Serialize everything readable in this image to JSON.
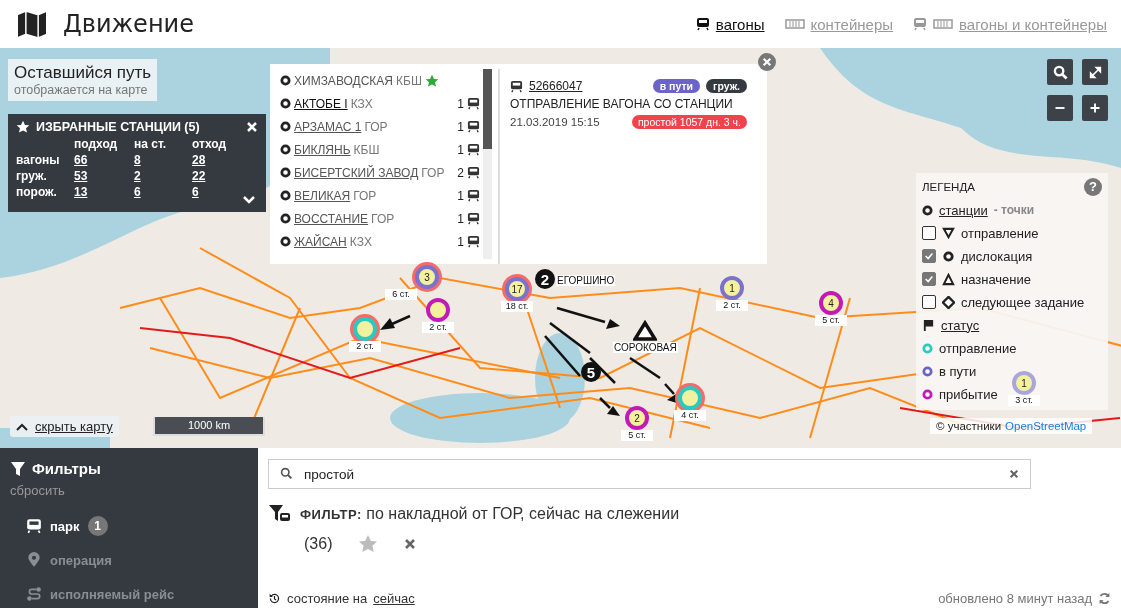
{
  "header": {
    "title": "Движение",
    "tabs": [
      {
        "label": "вагоны",
        "selected": true
      },
      {
        "label": "контейнеры",
        "selected": false
      },
      {
        "label": "вагоны и контейнеры",
        "selected": false
      }
    ]
  },
  "map": {
    "remaining_path": {
      "title": "Оставшийся путь",
      "subtitle": "отображается на карте"
    },
    "favorites": {
      "title": "ИЗБРАННЫЕ СТАНЦИИ (5)",
      "columns": [
        "подход",
        "на ст.",
        "отход"
      ],
      "rows": [
        {
          "label": "вагоны",
          "values": [
            "66",
            "8",
            "28"
          ]
        },
        {
          "label": "груж.",
          "values": [
            "53",
            "2",
            "22"
          ]
        },
        {
          "label": "порож.",
          "values": [
            "13",
            "6",
            "6"
          ]
        }
      ]
    },
    "popup": {
      "stations": [
        {
          "name": "ХИМЗАВОДСКАЯ",
          "road": "КБШ",
          "favorite": true,
          "selected": false
        },
        {
          "name": "АКТОБЕ I",
          "road": "КЗХ",
          "count": "1",
          "favorite": false,
          "selected": true
        },
        {
          "name": "АРЗАМАС 1",
          "road": "ГОР",
          "count": "1",
          "favorite": false,
          "selected": false
        },
        {
          "name": "БИКЛЯНЬ",
          "road": "КБШ",
          "count": "1",
          "favorite": false,
          "selected": false
        },
        {
          "name": "БИСЕРТСКИЙ ЗАВОД",
          "road": "ГОР",
          "count": "2",
          "favorite": false,
          "selected": false
        },
        {
          "name": "ВЕЛИКАЯ",
          "road": "ГОР",
          "count": "1",
          "favorite": false,
          "selected": false
        },
        {
          "name": "ВОССТАНИЕ",
          "road": "ГОР",
          "count": "1",
          "favorite": false,
          "selected": false
        },
        {
          "name": "ЖАЙСАН",
          "road": "КЗХ",
          "count": "1",
          "favorite": false,
          "selected": false
        }
      ],
      "wagon": {
        "number": "52666047",
        "badges": [
          {
            "text": "в пути",
            "color": "#6c63c9"
          },
          {
            "text": "груж.",
            "color": "#343a40"
          }
        ],
        "operation": "ОТПРАВЛЕНИЕ ВАГОНА СО СТАНЦИИ",
        "datetime": "21.03.2019 15:15",
        "idle": "простой 1057 дн. 3 ч."
      }
    },
    "markers": [
      {
        "count": "3",
        "label": "6 ст.",
        "color": "#7b72cc",
        "alert": true
      },
      {
        "label": "2 ст.",
        "color": "#c21bb5",
        "alert": false
      },
      {
        "label": "2 ст.",
        "color": "#2bc9c0",
        "alert": true
      },
      {
        "count": "17",
        "label": "18 ст.",
        "color": "#7b72cc",
        "alert": true
      },
      {
        "count": "1",
        "label": "2 ст.",
        "color": "#7b72cc",
        "alert": false
      },
      {
        "count": "4",
        "label": "5 ст.",
        "color": "#c21bb5",
        "alert": false
      },
      {
        "count": "1",
        "label": "3 ст.",
        "color": "#a9a6dc",
        "alert": false
      },
      {
        "label": "4 ст.",
        "color": "#2bc9c0",
        "alert": true
      },
      {
        "count": "2",
        "label": "5 ст.",
        "color": "#c21bb5",
        "alert": false
      }
    ],
    "route_points": [
      "2",
      "5"
    ],
    "route_stations": [
      "ЕГОРШИНО",
      "СОРОКОВАЯ"
    ],
    "legend": {
      "title": "ЛЕГЕНДА",
      "help": "?",
      "stations_link": "станции",
      "stations_text": "- точки",
      "layers": [
        {
          "label": "отправление",
          "checked": false,
          "kind": "down-triangle"
        },
        {
          "label": "дислокация",
          "checked": true,
          "kind": "circle"
        },
        {
          "label": "назначение",
          "checked": true,
          "kind": "triangle"
        },
        {
          "label": "следующее задание",
          "checked": false,
          "kind": "diamond"
        }
      ],
      "status_link": "статус",
      "statuses": [
        {
          "label": "отправление",
          "color": "#2bc9c0"
        },
        {
          "label": "в пути",
          "color": "#6c63c9"
        },
        {
          "label": "прибытие",
          "color": "#c21bb5"
        }
      ]
    },
    "attribution": {
      "text": "© участники",
      "link": "OpenStreetMap"
    },
    "hide_map": "скрыть карту",
    "scale": "1000 km"
  },
  "sidebar": {
    "title": "Фильтры",
    "reset": "сбросить",
    "items": [
      {
        "label": "парк",
        "badge": "1",
        "selected": true
      },
      {
        "label": "операция",
        "selected": false
      },
      {
        "label": "исполняемый рейс",
        "selected": false
      }
    ]
  },
  "main": {
    "search": {
      "value": "простой"
    },
    "filter": "**ФИЛЬТР:** по накладной от ГОР, сейчас на слежении",
    "count": "(36)",
    "state_label": "состояние на",
    "state_link": "сейчас",
    "updated": "обновлено 8 минут назад"
  }
}
